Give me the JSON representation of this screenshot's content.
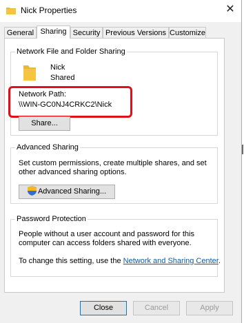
{
  "window": {
    "title": "Nick Properties",
    "close_glyph": "✕"
  },
  "tabs": [
    "General",
    "Sharing",
    "Security",
    "Previous Versions",
    "Customize"
  ],
  "active_tab": "Sharing",
  "network_sharing": {
    "heading": "Network File and Folder Sharing",
    "folder_name": "Nick",
    "folder_status": "Shared",
    "path_label": "Network Path:",
    "path_value": "\\\\WIN-GC0NJ4CRKC2\\Nick",
    "share_button": "Share..."
  },
  "advanced_sharing": {
    "heading": "Advanced Sharing",
    "description": "Set custom permissions, create multiple shares, and set other advanced sharing options.",
    "button": "Advanced Sharing..."
  },
  "password_protection": {
    "heading": "Password Protection",
    "description": "People without a user account and password for this computer can access folders shared with everyone.",
    "change_prefix": "To change this setting, use the ",
    "link_text": "Network and Sharing Center",
    "change_suffix": "."
  },
  "buttons": {
    "close": "Close",
    "cancel": "Cancel",
    "apply": "Apply"
  },
  "colors": {
    "highlight": "#e0101a",
    "link": "#0a5aa8",
    "folder": "#f5c542",
    "focus": "#0078d7"
  }
}
